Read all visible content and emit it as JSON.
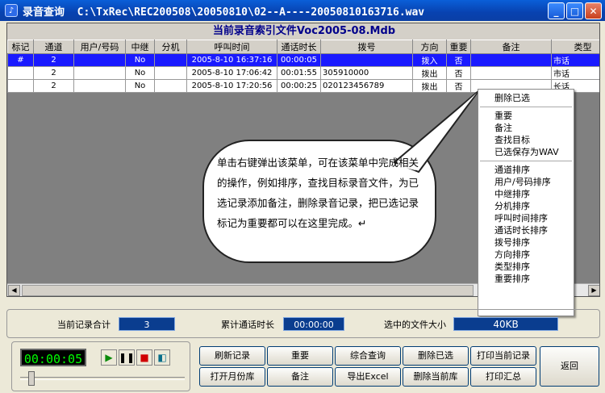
{
  "window": {
    "title": "录音查询",
    "path": "C:\\TxRec\\REC200508\\20050810\\02--A----20050810163716.wav"
  },
  "grid": {
    "caption": "当前录音索引文件Voc2005-08.Mdb",
    "columns": [
      "标记",
      "通道",
      "用户/号码",
      "中继",
      "分机",
      "呼叫时间",
      "通话时长",
      "拨号",
      "方向",
      "重要",
      "备注",
      "类型"
    ],
    "rows": [
      [
        "#",
        "2",
        "",
        "No",
        "",
        "2005-8-10 16:37:16",
        "00:00:05",
        "",
        "拨入",
        "否",
        "",
        "市话"
      ],
      [
        "",
        "2",
        "",
        "No",
        "",
        "2005-8-10 17:06:42",
        "00:01:55",
        "305910000",
        "拨出",
        "否",
        "",
        "市话"
      ],
      [
        "",
        "2",
        "",
        "No",
        "",
        "2005-8-10 17:20:56",
        "00:00:25",
        "020123456789",
        "拨出",
        "否",
        "",
        "长话"
      ]
    ]
  },
  "context_menu": {
    "groups": [
      [
        "删除已选"
      ],
      [
        "重要",
        "备注",
        "查找目标",
        "已选保存为WAV"
      ],
      [
        "通道排序",
        "用户/号码排序",
        "中继排序",
        "分机排序",
        "呼叫时间排序",
        "通话时长排序",
        "拨号排序",
        "方向排序",
        "类型排序",
        "重要排序"
      ]
    ]
  },
  "callout": {
    "text": "单击右键弹出该菜单，可在该菜单中完成相关的操作，例如排序，查找目标录音文件，为已选记录添加备注，删除录音记录，把已选记录标记为重要都可以在这里完成。↵"
  },
  "stats": {
    "count_label": "当前记录合计",
    "count_value": "3",
    "duration_label": "累计通话时长",
    "duration_value": "00:00:00",
    "size_label": "选中的文件大小",
    "size_value": "40KB"
  },
  "player": {
    "time": "00:00:05",
    "position_fraction": 0.05
  },
  "buttons": {
    "refresh": "刷新记录",
    "important": "重要",
    "query": "综合查询",
    "delete_selected": "删除已选",
    "print_current": "打印当前记录",
    "back": "返回",
    "open_month": "打开月份库",
    "note": "备注",
    "export_excel": "导出Excel",
    "delete_db": "删除当前库",
    "print_summary": "打印汇总"
  },
  "colors": {
    "titlebar": "#0842b0",
    "selected_row": "#1a1aff",
    "stat_box": "#0a3d8f",
    "lcd_text": "#00ff00"
  }
}
